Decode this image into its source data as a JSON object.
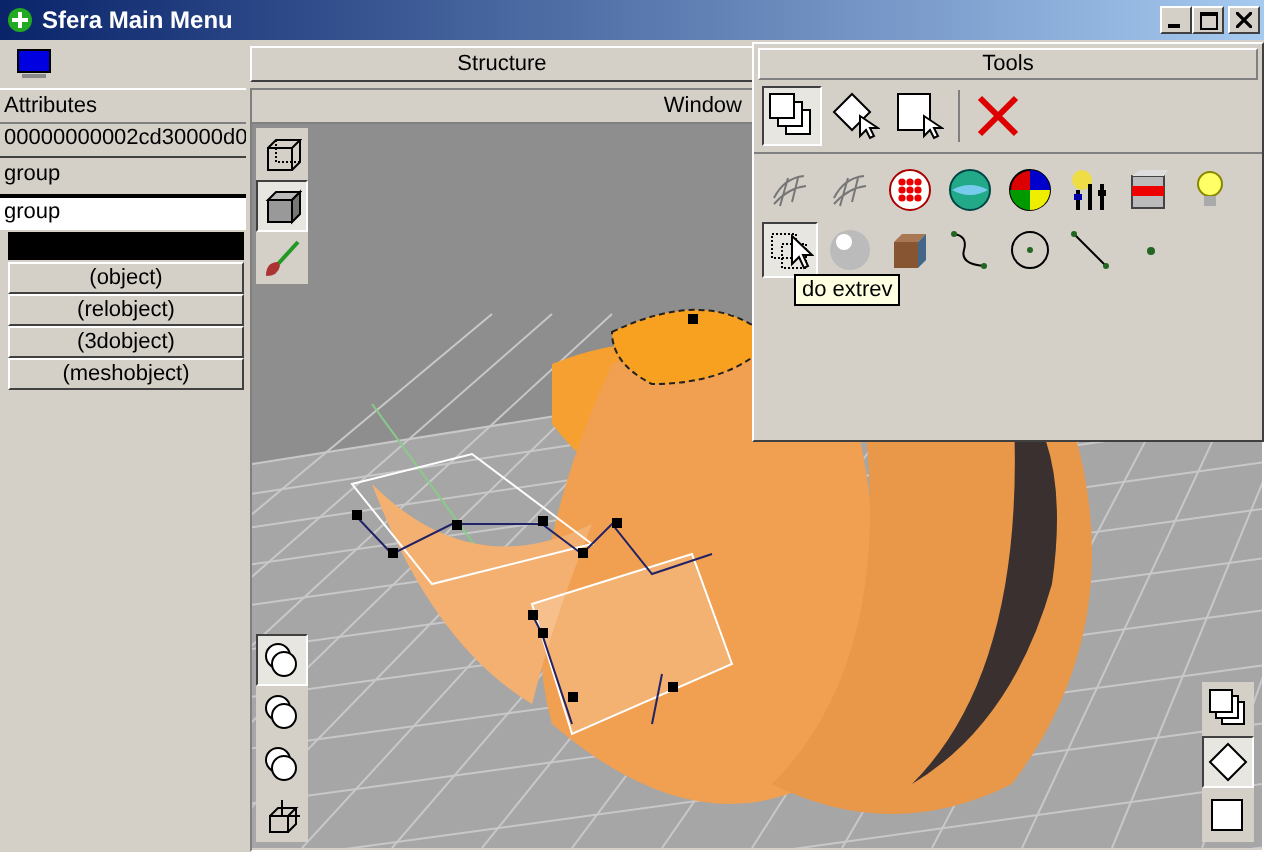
{
  "window": {
    "title": "Sfera Main Menu"
  },
  "structure": {
    "label": "Structure"
  },
  "attributes": {
    "label": "Attributes",
    "id": "00000000002cd30000d0",
    "type": "group",
    "name": "group",
    "classes": [
      "(object)",
      "(relobject)",
      "(3dobject)",
      "(meshobject)"
    ]
  },
  "viewport": {
    "title": "Window",
    "view_modes": [
      {
        "selected": false
      },
      {
        "selected": true
      },
      {
        "selected": false
      }
    ],
    "transform_tools": [
      {
        "selected": true
      },
      {
        "selected": false
      },
      {
        "selected": false
      },
      {
        "selected": false
      }
    ],
    "layer_modes": [
      {
        "selected": false
      },
      {
        "selected": true
      },
      {
        "selected": false
      }
    ]
  },
  "tools": {
    "title": "Tools",
    "actions": [
      {
        "selected": true
      },
      {
        "selected": false
      },
      {
        "selected": false
      },
      {
        "selected": false
      }
    ],
    "primitives": [
      {
        "selected": false
      },
      {
        "selected": false
      },
      {
        "selected": false
      },
      {
        "selected": false
      },
      {
        "selected": false
      },
      {
        "selected": false
      },
      {
        "selected": false
      },
      {
        "selected": false
      },
      {
        "selected": true
      },
      {
        "selected": false
      },
      {
        "selected": false
      },
      {
        "selected": false
      },
      {
        "selected": false
      },
      {
        "selected": false
      },
      {
        "selected": false
      }
    ],
    "tooltip": "do extrev"
  }
}
